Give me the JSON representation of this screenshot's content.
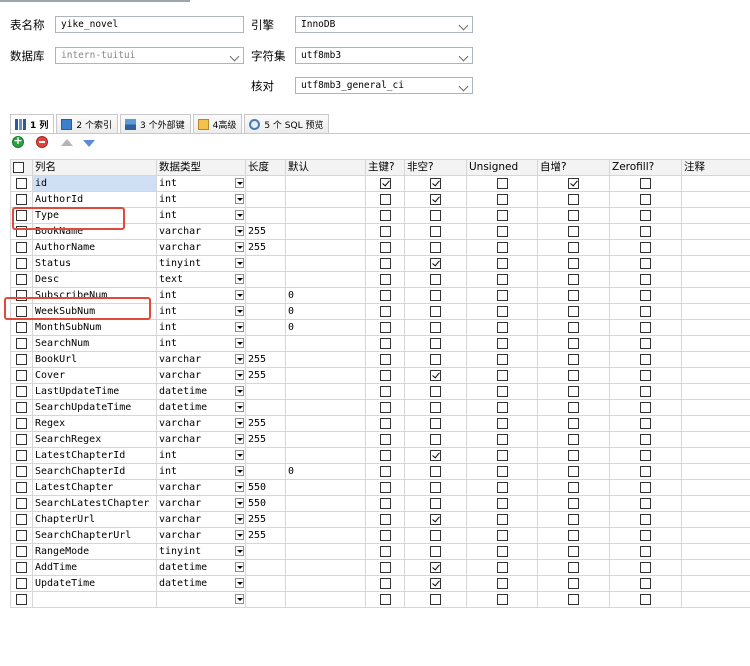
{
  "form": {
    "table_name_label": "表名称",
    "table_name_value": "yike_novel",
    "database_label": "数据库",
    "database_value": "intern-tuitui",
    "engine_label": "引擎",
    "engine_value": "InnoDB",
    "charset_label": "字符集",
    "charset_value": "utf8mb3",
    "collation_label": "核对",
    "collation_value": "utf8mb3_general_ci"
  },
  "tabs": [
    {
      "label": "1 列",
      "icon": "columns-icon"
    },
    {
      "label": "2 个索引",
      "icon": "index-icon"
    },
    {
      "label": "3 个外部键",
      "icon": "foreign-key-icon"
    },
    {
      "label": "4高级",
      "icon": "advanced-icon"
    },
    {
      "label": "5 个 SQL 预览",
      "icon": "sql-preview-icon"
    }
  ],
  "toolbar": {
    "add_icon": "add-column-icon",
    "delete_icon": "delete-column-icon",
    "up_icon": "move-up-icon",
    "down_icon": "move-down-icon"
  },
  "grid": {
    "headers": [
      "列名",
      "数据类型",
      "长度",
      "默认",
      "主键?",
      "非空?",
      "Unsigned",
      "自增?",
      "Zerofill?",
      "注释"
    ],
    "rows": [
      {
        "name": "id",
        "type": "int",
        "length": "",
        "default": "",
        "pk": true,
        "nn": true,
        "unsigned": false,
        "ai": true,
        "zf": false
      },
      {
        "name": "AuthorId",
        "type": "int",
        "length": "",
        "default": "",
        "pk": false,
        "nn": true,
        "unsigned": false,
        "ai": false,
        "zf": false
      },
      {
        "name": "Type",
        "type": "int",
        "length": "",
        "default": "",
        "pk": false,
        "nn": false,
        "unsigned": false,
        "ai": false,
        "zf": false
      },
      {
        "name": "BookName",
        "type": "varchar",
        "length": "255",
        "default": "",
        "pk": false,
        "nn": false,
        "unsigned": false,
        "ai": false,
        "zf": false
      },
      {
        "name": "AuthorName",
        "type": "varchar",
        "length": "255",
        "default": "",
        "pk": false,
        "nn": false,
        "unsigned": false,
        "ai": false,
        "zf": false
      },
      {
        "name": "Status",
        "type": "tinyint",
        "length": "",
        "default": "",
        "pk": false,
        "nn": true,
        "unsigned": false,
        "ai": false,
        "zf": false
      },
      {
        "name": "Desc",
        "type": "text",
        "length": "",
        "default": "",
        "pk": false,
        "nn": false,
        "unsigned": false,
        "ai": false,
        "zf": false
      },
      {
        "name": "SubscribeNum",
        "type": "int",
        "length": "",
        "default": "0",
        "pk": false,
        "nn": false,
        "unsigned": false,
        "ai": false,
        "zf": false
      },
      {
        "name": "WeekSubNum",
        "type": "int",
        "length": "",
        "default": "0",
        "pk": false,
        "nn": false,
        "unsigned": false,
        "ai": false,
        "zf": false
      },
      {
        "name": "MonthSubNum",
        "type": "int",
        "length": "",
        "default": "0",
        "pk": false,
        "nn": false,
        "unsigned": false,
        "ai": false,
        "zf": false
      },
      {
        "name": "SearchNum",
        "type": "int",
        "length": "",
        "default": "",
        "pk": false,
        "nn": false,
        "unsigned": false,
        "ai": false,
        "zf": false
      },
      {
        "name": "BookUrl",
        "type": "varchar",
        "length": "255",
        "default": "",
        "pk": false,
        "nn": false,
        "unsigned": false,
        "ai": false,
        "zf": false
      },
      {
        "name": "Cover",
        "type": "varchar",
        "length": "255",
        "default": "",
        "pk": false,
        "nn": true,
        "unsigned": false,
        "ai": false,
        "zf": false
      },
      {
        "name": "LastUpdateTime",
        "type": "datetime",
        "length": "",
        "default": "",
        "pk": false,
        "nn": false,
        "unsigned": false,
        "ai": false,
        "zf": false
      },
      {
        "name": "SearchUpdateTime",
        "type": "datetime",
        "length": "",
        "default": "",
        "pk": false,
        "nn": false,
        "unsigned": false,
        "ai": false,
        "zf": false
      },
      {
        "name": "Regex",
        "type": "varchar",
        "length": "255",
        "default": "",
        "pk": false,
        "nn": false,
        "unsigned": false,
        "ai": false,
        "zf": false
      },
      {
        "name": "SearchRegex",
        "type": "varchar",
        "length": "255",
        "default": "",
        "pk": false,
        "nn": false,
        "unsigned": false,
        "ai": false,
        "zf": false
      },
      {
        "name": "LatestChapterId",
        "type": "int",
        "length": "",
        "default": "",
        "pk": false,
        "nn": true,
        "unsigned": false,
        "ai": false,
        "zf": false
      },
      {
        "name": "SearchChapterId",
        "type": "int",
        "length": "",
        "default": "0",
        "pk": false,
        "nn": false,
        "unsigned": false,
        "ai": false,
        "zf": false
      },
      {
        "name": "LatestChapter",
        "type": "varchar",
        "length": "550",
        "default": "",
        "pk": false,
        "nn": false,
        "unsigned": false,
        "ai": false,
        "zf": false
      },
      {
        "name": "SearchLatestChapter",
        "type": "varchar",
        "length": "550",
        "default": "",
        "pk": false,
        "nn": false,
        "unsigned": false,
        "ai": false,
        "zf": false
      },
      {
        "name": "ChapterUrl",
        "type": "varchar",
        "length": "255",
        "default": "",
        "pk": false,
        "nn": true,
        "unsigned": false,
        "ai": false,
        "zf": false
      },
      {
        "name": "SearchChapterUrl",
        "type": "varchar",
        "length": "255",
        "default": "",
        "pk": false,
        "nn": false,
        "unsigned": false,
        "ai": false,
        "zf": false
      },
      {
        "name": "RangeMode",
        "type": "tinyint",
        "length": "",
        "default": "",
        "pk": false,
        "nn": false,
        "unsigned": false,
        "ai": false,
        "zf": false
      },
      {
        "name": "AddTime",
        "type": "datetime",
        "length": "",
        "default": "",
        "pk": false,
        "nn": true,
        "unsigned": false,
        "ai": false,
        "zf": false
      },
      {
        "name": "UpdateTime",
        "type": "datetime",
        "length": "",
        "default": "",
        "pk": false,
        "nn": true,
        "unsigned": false,
        "ai": false,
        "zf": false
      },
      {
        "name": "",
        "type": "",
        "length": "",
        "default": "",
        "pk": false,
        "nn": false,
        "unsigned": false,
        "ai": false,
        "zf": false
      }
    ]
  },
  "highlight_color": "#e04a3a",
  "selection_color": "#cfe0f5"
}
